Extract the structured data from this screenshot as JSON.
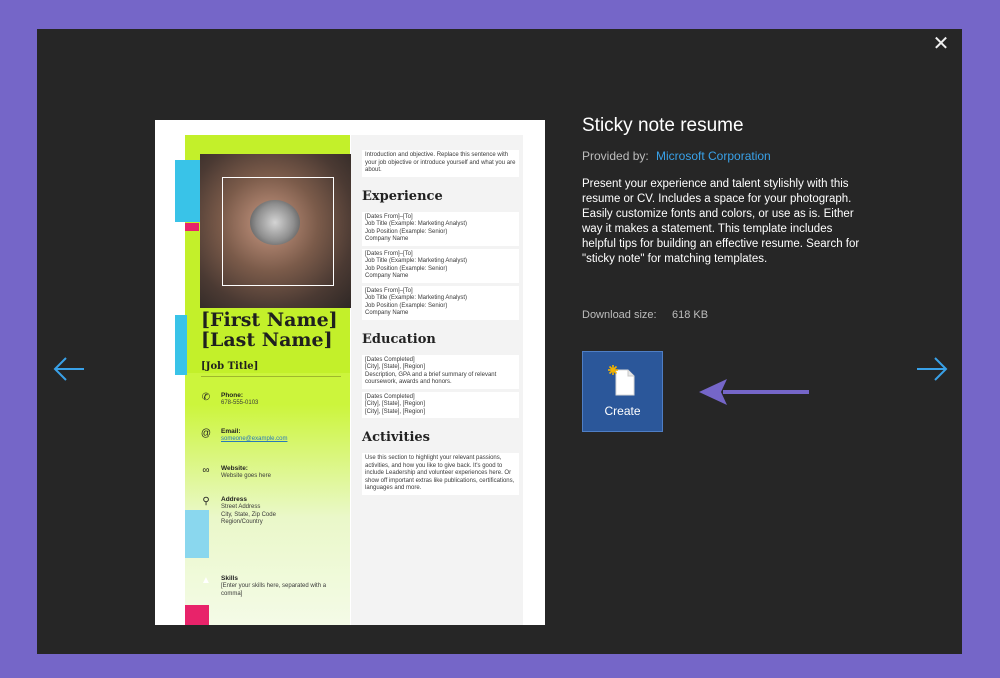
{
  "dialog": {
    "close_icon": "close-icon",
    "prev_icon": "arrow-left-icon",
    "next_icon": "arrow-right-icon",
    "accent_arrow_color": "#39a1e8"
  },
  "template": {
    "title": "Sticky note resume",
    "provided_by_label": "Provided by:",
    "provider": "Microsoft Corporation",
    "description": "Present your experience and talent stylishly with this resume or CV.  Includes a space for your photograph.  Easily customize fonts and colors, or use as is.  Either way it makes a statement. This template includes helpful tips for building an effective resume. Search for \"sticky note\" for matching templates.",
    "download_size_label": "Download size:",
    "download_size": "618 KB",
    "create_label": "Create",
    "create_icon": "new-document-icon",
    "pointer_arrow_color": "#7566c8"
  },
  "preview": {
    "name": "[First Name]\n[Last Name]",
    "job_title": "[Job Title]",
    "intro": "Introduction and objective. Replace this sentence with your job objective or introduce yourself and what you are about.",
    "experience_heading": "Experience",
    "jobs": [
      {
        "dates": "[Dates From]–[To]",
        "title": "Job Title (Example: Marketing Analyst)",
        "position": "Job Position (Example: Senior)",
        "company": "Company Name"
      },
      {
        "dates": "[Dates From]–[To]",
        "title": "Job Title (Example: Marketing Analyst)",
        "position": "Job Position (Example: Senior)",
        "company": "Company Name"
      },
      {
        "dates": "[Dates From]–[To]",
        "title": "Job Title (Example: Marketing Analyst)",
        "position": "Job Position (Example: Senior)",
        "company": "Company Name"
      }
    ],
    "education_heading": "Education",
    "education": [
      {
        "dates": "[Dates Completed]",
        "lines": "[City], [State], [Region]\nDescription, GPA and a brief summary of relevant coursework, awards and honors."
      },
      {
        "dates": "[Dates Completed]",
        "lines": "[City], [State], [Region]\n[City], [State], [Region]"
      }
    ],
    "activities_heading": "Activities",
    "activities": "Use this section to highlight your relevant passions, activities, and how you like to give back. It's good to include Leadership and volunteer experiences here. Or show off important extras like publications, certifications, languages and more.",
    "contact": [
      {
        "icon": "phone-icon",
        "label": "Phone:",
        "value": "678-555-0103"
      },
      {
        "icon": "email-icon",
        "label": "Email:",
        "value": "someone@example.com"
      },
      {
        "icon": "link-icon",
        "label": "Website:",
        "value": "Website goes here"
      },
      {
        "icon": "location-pin-icon",
        "label": "Address",
        "value": "Street Address\nCity, State, Zip Code\nRegion/Country"
      },
      {
        "icon": "skills-icon",
        "label": "Skills",
        "value": "[Enter your skills here, separated with a comma]"
      }
    ]
  }
}
